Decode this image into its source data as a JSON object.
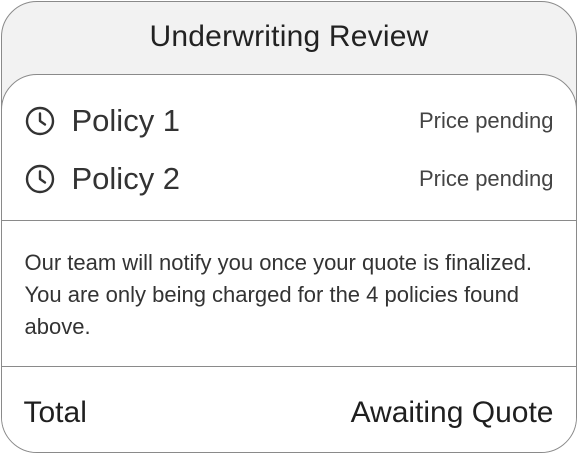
{
  "header": {
    "title": "Underwriting Review"
  },
  "policies": [
    {
      "name": "Policy 1",
      "status": "Price pending",
      "icon": "clock-icon"
    },
    {
      "name": "Policy 2",
      "status": "Price pending",
      "icon": "clock-icon"
    }
  ],
  "notice": {
    "text": "Our team will notify you once your quote is finalized. You are only being charged for the 4 policies found above."
  },
  "total": {
    "label": "Total",
    "value": "Awaiting Quote"
  },
  "colors": {
    "border": "#8a8a8a",
    "header_bg": "#f2f2f2",
    "body_bg": "#ffffff",
    "text": "#1f1f1f"
  }
}
